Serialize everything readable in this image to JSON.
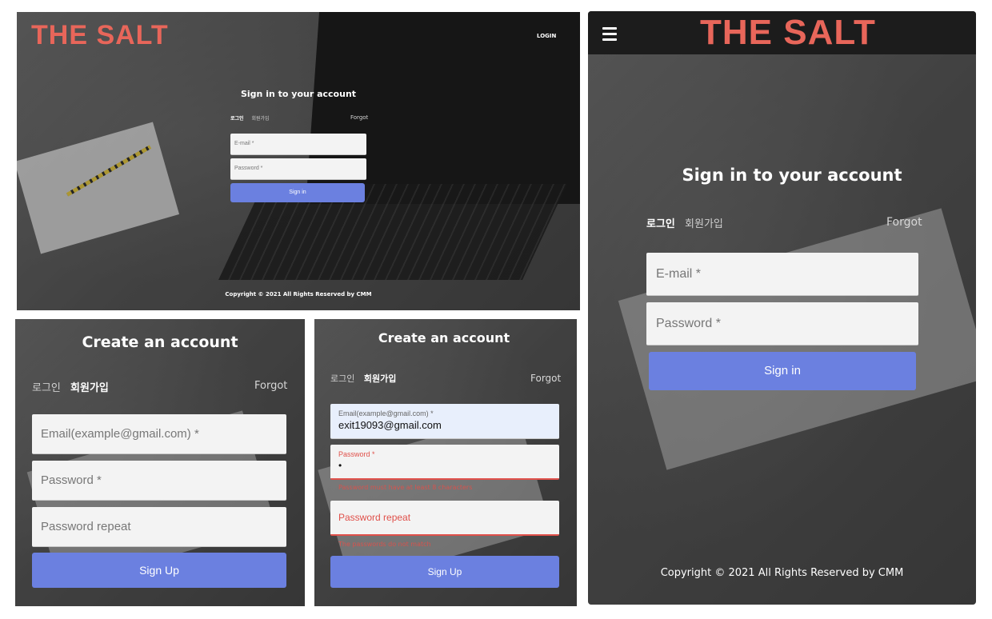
{
  "brand": {
    "logo": "THE SALT",
    "accent": "#e8665a"
  },
  "desktop_signin": {
    "nav_login": "LOGIN",
    "title": "Sign in to your account",
    "tabs": [
      "로그인",
      "회원가입"
    ],
    "forgot": "Forgot",
    "email_placeholder": "E-mail *",
    "password_placeholder": "Password *",
    "signin_label": "Sign in",
    "footer": "Copyright © 2021 All Rights Reserved by CMM"
  },
  "signup_empty": {
    "title": "Create an account",
    "tabs": [
      "로그인",
      "회원가입"
    ],
    "forgot": "Forgot",
    "email_placeholder": "Email(example@gmail.com) *",
    "password_placeholder": "Password *",
    "password_repeat_placeholder": "Password repeat",
    "signup_label": "Sign Up"
  },
  "signup_filled": {
    "title": "Create an account",
    "tabs": [
      "로그인",
      "회원가입"
    ],
    "forgot": "Forgot",
    "email_label": "Email(example@gmail.com) *",
    "email_value": "exit19093@gmail.com",
    "password_label": "Password *",
    "password_value": "•",
    "password_error": "Password must have at least 8 characters",
    "password_repeat_label": "Password repeat",
    "password_repeat_error": "The passwords do not match",
    "signup_label": "Sign Up"
  },
  "mobile_signin": {
    "title": "Sign in to your account",
    "tabs": [
      "로그인",
      "회원가입"
    ],
    "forgot": "Forgot",
    "email_placeholder": "E-mail *",
    "password_placeholder": "Password *",
    "signin_label": "Sign in",
    "footer": "Copyright © 2021 All Rights Reserved by CMM"
  },
  "colors": {
    "button": "#6b80e0",
    "error": "#e0504a",
    "header_dark": "#1c1c1c"
  }
}
